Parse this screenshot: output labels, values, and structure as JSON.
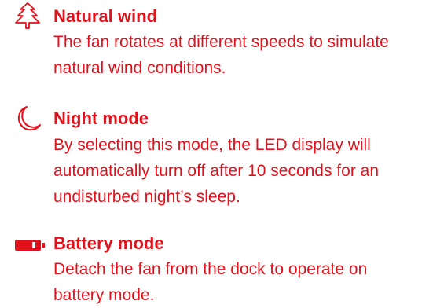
{
  "theme": {
    "accent_color": "#e3111b"
  },
  "features": [
    {
      "icon": "tree-icon",
      "title": "Natural wind",
      "description": "The fan rotates at different speeds to simulate natural wind conditions."
    },
    {
      "icon": "crescent-moon-icon",
      "title": "Night mode",
      "description": "By selecting this mode, the LED display will automatically turn off after 10 seconds for an undisturbed night’s sleep."
    },
    {
      "icon": "battery-icon",
      "title": "Battery mode",
      "description": "Detach the fan from the dock to operate on battery mode."
    }
  ]
}
